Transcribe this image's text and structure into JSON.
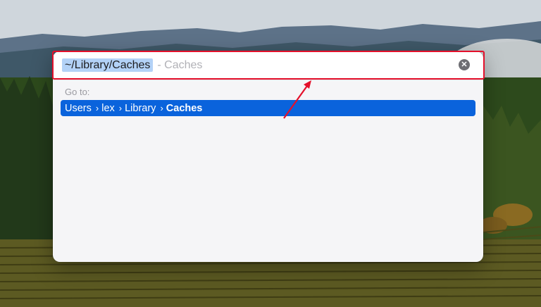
{
  "goto_dialog": {
    "path_value": "~/Library/Caches",
    "completion_hint": "- Caches",
    "section_label": "Go to:",
    "result_breadcrumb": [
      {
        "label": "Users"
      },
      {
        "label": "lex"
      },
      {
        "label": "Library"
      },
      {
        "label": "Caches"
      }
    ],
    "breadcrumb_separator": "›",
    "clear_icon": "clear-circle-x-icon"
  },
  "colors": {
    "selection_highlight": "#0a63dc",
    "annotation_red": "#e4102b"
  }
}
